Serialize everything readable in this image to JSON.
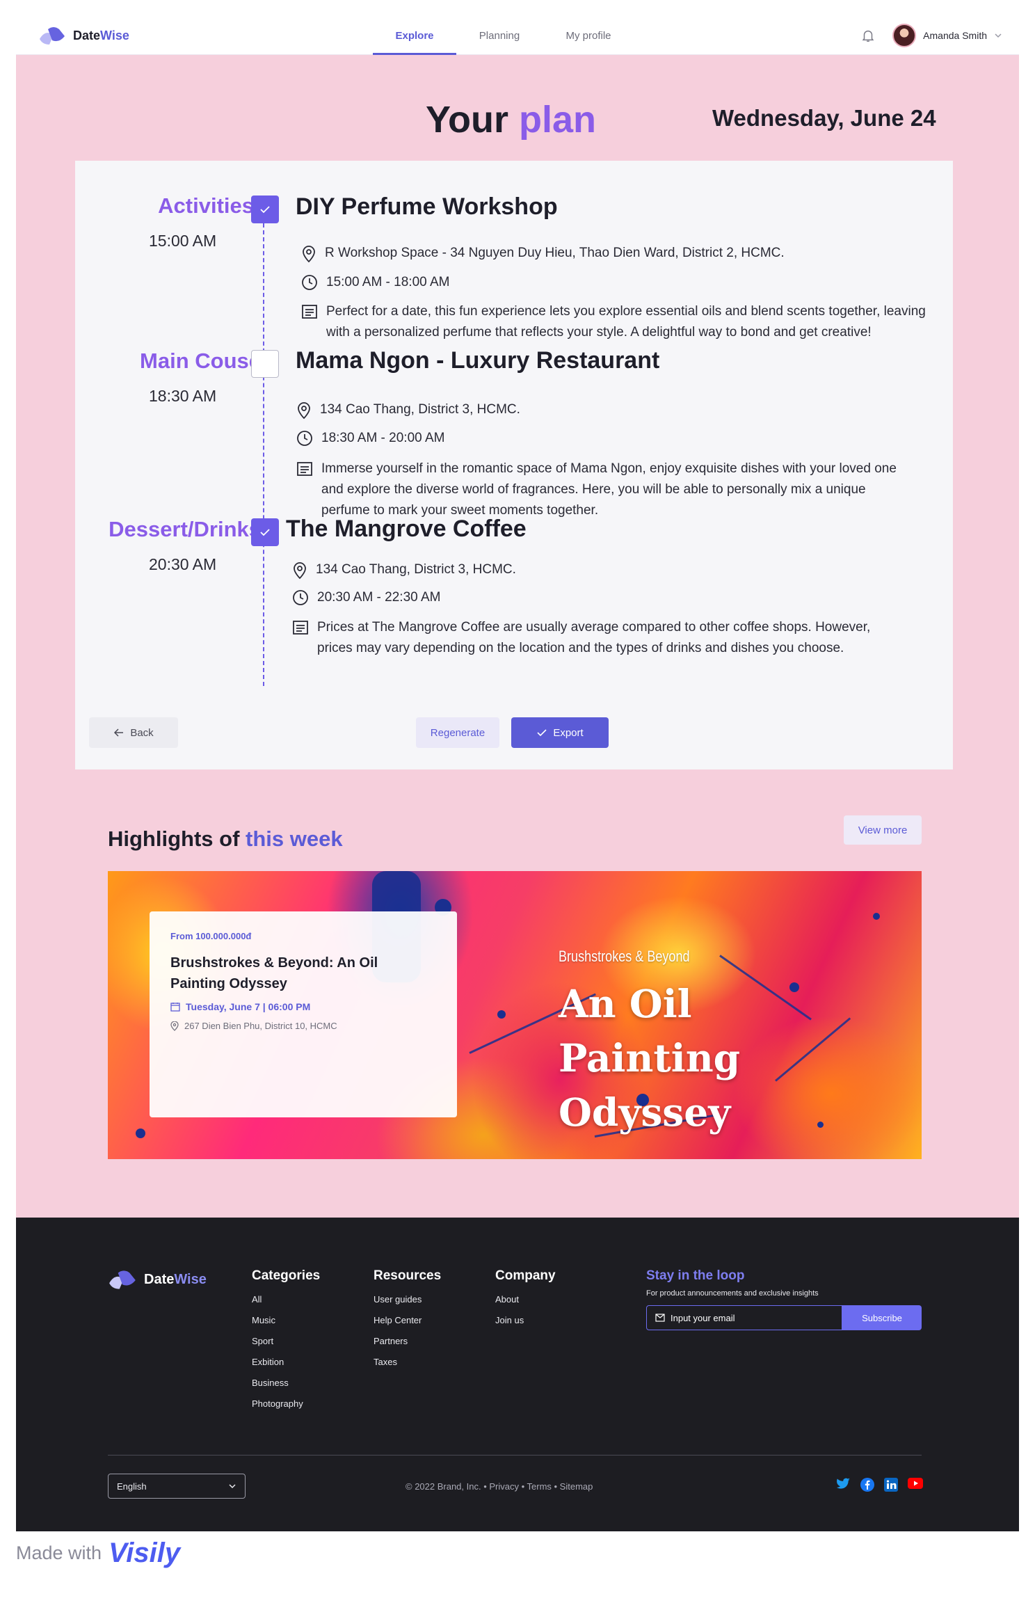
{
  "app": {
    "logo_part1": "Date",
    "logo_part2": "Wise"
  },
  "nav": {
    "tabs": [
      {
        "label": "Explore",
        "active": true
      },
      {
        "label": "Planning",
        "active": false
      },
      {
        "label": "My profile",
        "active": false
      }
    ]
  },
  "user": {
    "name": "Amanda Smith"
  },
  "page": {
    "title_part1": "Your",
    "title_part2": "plan",
    "date": "Wednesday, June 24"
  },
  "plan": {
    "items": [
      {
        "category": "Activities",
        "time": "15:00 AM",
        "checked": true,
        "venue": "DIY Perfume Workshop",
        "address": "R Workshop Space - 34 Nguyen Duy Hieu, Thao Dien Ward, District 2, HCMC.",
        "hours": "15:00 AM - 18:00 AM",
        "description": "Perfect for a date, this fun experience lets you explore essential oils and blend scents together, leaving with a personalized perfume that reflects your style. A delightful way to bond and get creative!"
      },
      {
        "category": "Main Couse",
        "time": "18:30 AM",
        "checked": false,
        "venue": "Mama Ngon - Luxury Restaurant",
        "address": "134 Cao Thang, District 3, HCMC.",
        "hours": "18:30 AM - 20:00 AM",
        "description": "Immerse yourself in the romantic space of Mama Ngon, enjoy exquisite dishes with your loved one and explore the diverse world of fragrances. Here, you will be able to personally mix a unique perfume to mark your sweet moments together."
      },
      {
        "category": "Dessert/Drinks",
        "time": "20:30 AM",
        "checked": true,
        "venue": "The Mangrove Coffee",
        "address": "134 Cao Thang, District 3, HCMC.",
        "hours": "20:30 AM - 22:30 AM",
        "description": "Prices at The Mangrove Coffee are usually average compared to other coffee shops. However, prices may vary depending on the location and the types of drinks and dishes you choose."
      }
    ],
    "back_label": "Back",
    "regenerate_label": "Regenerate",
    "export_label": "Export"
  },
  "highlights": {
    "title_part1": "Highlights of",
    "title_part2": "this week",
    "view_more": "View more",
    "event": {
      "price_prefix": "From",
      "price": "100.000.000đ",
      "name": "Brushstrokes & Beyond: An Oil Painting Odyssey",
      "date": "Tuesday, June 7 | 06:00 PM",
      "location": "267 Dien Bien Phu, District 10, HCMC",
      "poster_subtitle": "Brushstrokes & Beyond",
      "poster_title": "An Oil Painting Odyssey"
    }
  },
  "footer": {
    "logo_part1": "Date",
    "logo_part2": "Wise",
    "categories": {
      "title": "Categories",
      "items": [
        "All",
        "Music",
        "Sport",
        "Exbition",
        "Business",
        "Photography"
      ]
    },
    "resources": {
      "title": "Resources",
      "items": [
        "User guides",
        "Help Center",
        "Partners",
        "Taxes"
      ]
    },
    "company": {
      "title": "Company",
      "items": [
        "About",
        "Join us"
      ]
    },
    "newsletter": {
      "title": "Stay in the loop",
      "text": "For product announcements and exclusive insights",
      "placeholder": "Input your email",
      "button": "Subscribe"
    },
    "language": "English",
    "copyright": "© 2022 Brand, Inc. • Privacy • Terms • Sitemap",
    "socials": [
      "twitter-icon",
      "facebook-icon",
      "linkedin-icon",
      "youtube-icon"
    ]
  },
  "watermark": {
    "prefix": "Made with",
    "brand": "Visily"
  },
  "colors": {
    "accent": "#5b5bd6",
    "purple": "#8a5ce8",
    "background": "#f6cfdc",
    "footer": "#1d1d22"
  }
}
